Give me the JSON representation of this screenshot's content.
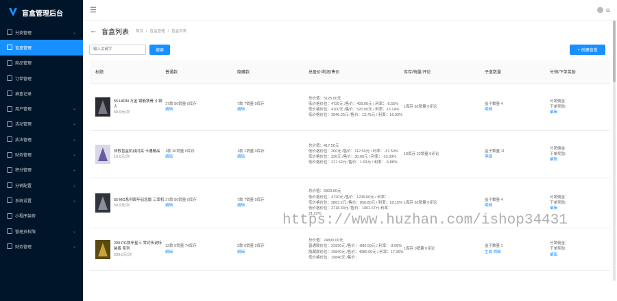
{
  "sidebar": {
    "title": "盲盒管理后台",
    "items": [
      {
        "label": "分类管理",
        "chevron": true,
        "active": false
      },
      {
        "label": "盲盒管理",
        "chevron": false,
        "active": true
      },
      {
        "label": "商品管理",
        "chevron": false,
        "active": false
      },
      {
        "label": "订单管理",
        "chevron": false,
        "active": false
      },
      {
        "label": "抽盒记录",
        "chevron": false,
        "active": false
      },
      {
        "label": "用户管理",
        "chevron": true,
        "active": false
      },
      {
        "label": "活动管理",
        "chevron": true,
        "active": false
      },
      {
        "label": "执法管理",
        "chevron": true,
        "active": false
      },
      {
        "label": "财务管理",
        "chevron": true,
        "active": false
      },
      {
        "label": "积分管理",
        "chevron": true,
        "active": false
      },
      {
        "label": "分销配置",
        "chevron": true,
        "active": false
      },
      {
        "label": "系统设置",
        "chevron": true,
        "active": false
      },
      {
        "label": "小程序装修",
        "chevron": false,
        "active": false
      },
      {
        "label": "管理员权限",
        "chevron": true,
        "active": false
      },
      {
        "label": "财务管理",
        "chevron": true,
        "active": false
      }
    ]
  },
  "topbar": {
    "menu_icon": "hamburger-icon",
    "user_name": "山"
  },
  "page": {
    "title": "盲盒列表",
    "breadcrumb": [
      "首页",
      "盲盒管理",
      "盲盒列表"
    ]
  },
  "toolbar": {
    "search_placeholder": "输入关键字",
    "search_label": "搜索",
    "create_label": "+ 创建盲盒"
  },
  "table": {
    "headers": [
      "标题",
      "普通款",
      "隐藏款",
      "总盈价/利润/售价",
      "库存/销量/评论",
      "子盒数量",
      "分销/下单奖励"
    ],
    "rows": [
      {
        "name": "55-HIRM 万金 钢筋铁骨 小钢人",
        "price": "59.9元/次",
        "normal": "17款  80销量  0库存",
        "normal_edit": "编辑",
        "hidden": "7款  7销量  0库存",
        "hidden_edit": "编辑",
        "profit": [
          "总价值：5125.00元",
          "低价格价位：4720元 /售价：409.00元 / 利率：-5.55%",
          "低价格价位：4100元 /售价：520.00元 / 利率：15.14%",
          "低价格价位：3946.25元 /售价：13.75元 / 利率：16.99%"
        ],
        "stock": "1库存  82销量  0评论",
        "sub": "盒子数量 4",
        "sub_link": "明细",
        "dist": "分销佣金：",
        "dist2": "下单奖励：",
        "dist_edit": "编辑"
      },
      {
        "name": "休假盲盒机战闪亮 卡通精品",
        "price": "10.0元/次",
        "normal": "1款  30销量  0库存",
        "normal_edit": "编辑",
        "hidden": "1款  1销量  0库存",
        "hidden_edit": "编辑",
        "profit": [
          "总价值：417.50元",
          "低价格价位：200元 /售价：112.50元 / 利率：-37.50%",
          "低价格价位：330元 /售价：30.00元 / 利率：-10.00%",
          "低价格价位：217.62元 /售价：1.63元 / 利率：-5.88%"
        ],
        "stock": "10库存  32销量  0评论",
        "sub": "盒子数量 11",
        "sub_link": "明细",
        "dist": "分销佣金：",
        "dist2": "下单奖励：",
        "dist_edit": "编辑"
      },
      {
        "name": "55-MG系列周年纪念版 三幸机",
        "price": "59.9元/次",
        "normal": "17款  80销量  0库存",
        "normal_edit": "编辑",
        "hidden": "7款  7销量  0库存",
        "hidden_edit": "编辑",
        "profit": [
          "总价值：6829.00元",
          "低价格价位：4720元 /售价：1239.00元 / 利率：-",
          "低价格价位：3863.2元 /售价：856.80元 / 利率：18.15%",
          "低价格价位：2718.33元 /售价：1001.67元 利率：21.22%"
        ],
        "stock": "1库存  82销量  0评论",
        "sub": "盒子数量 4",
        "sub_link": "明细",
        "dist": "分销佣金：",
        "dist2": "下单奖励：",
        "dist_edit": "编辑"
      },
      {
        "name": "299-PG铁甲星三 零式传说特装版 系列",
        "price": "299.0元/次",
        "normal": "12款  0销量  74库存",
        "normal_edit": "编辑",
        "hidden": "2款  0销量  2库存",
        "hidden_edit": "编辑",
        "profit": [
          "总价值：24800.00元",
          "普通款价位：23920元 /售价：-880.00元 / 利率：-3.68%",
          "隐藏款价位：19840元 /售价：4080.00元 / 利率：17.06%",
          "低价格价位：19840元 /售价："
        ],
        "stock": "1库存  0销量  0评论",
        "sub": "盒子数量 1",
        "sub_link": "生成  明细",
        "dist": "分销佣金：",
        "dist2": "下单奖励：",
        "dist_edit": "编辑"
      }
    ]
  },
  "watermark": "https://www.huzhan.com/ishop34431",
  "colors": {
    "sidebar_bg": "#001529",
    "accent": "#1890ff"
  }
}
